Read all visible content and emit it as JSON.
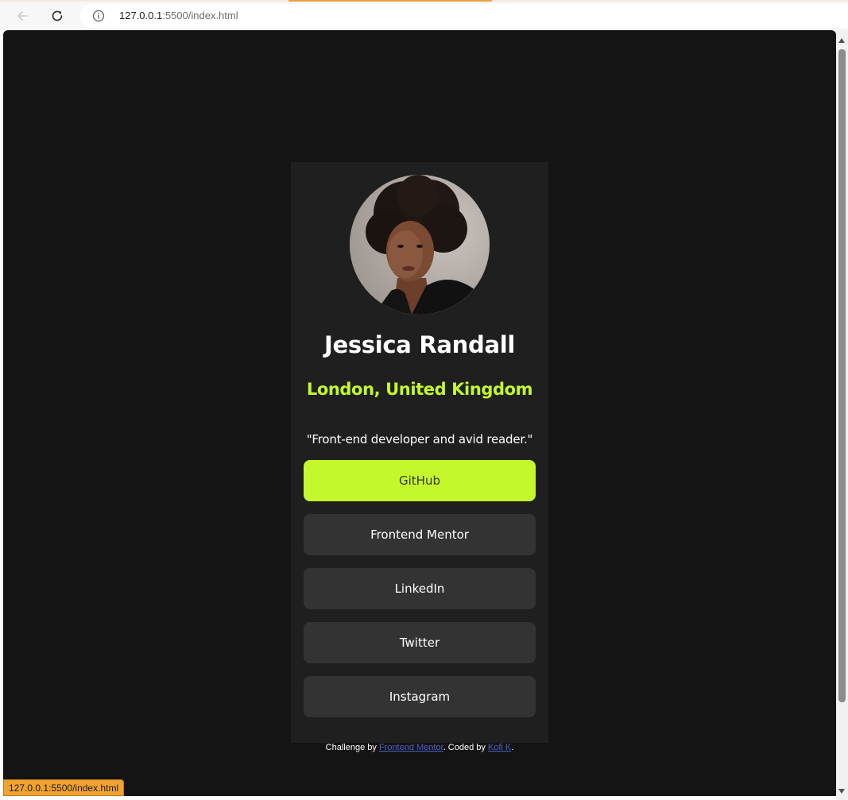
{
  "browser": {
    "url_host": "127.0.0.1",
    "url_rest": ":5500/index.html",
    "status_url": "127.0.0.1:5500/index.html"
  },
  "profile": {
    "name": "Jessica Randall",
    "location": "London, United Kingdom",
    "bio": "\"Front-end developer and avid reader.\"",
    "links": [
      {
        "label": "GitHub"
      },
      {
        "label": "Frontend Mentor"
      },
      {
        "label": "LinkedIn"
      },
      {
        "label": "Twitter"
      },
      {
        "label": "Instagram"
      }
    ]
  },
  "attribution": {
    "prefix": "Challenge by ",
    "challenge_link": "Frontend Mentor",
    "middle": ". Coded by ",
    "author_link": "Kofi K",
    "suffix": "."
  },
  "colors": {
    "accent": "#c4f82a",
    "page_bg": "#141414",
    "card_bg": "#1f1f1f",
    "button_bg": "#333333"
  }
}
